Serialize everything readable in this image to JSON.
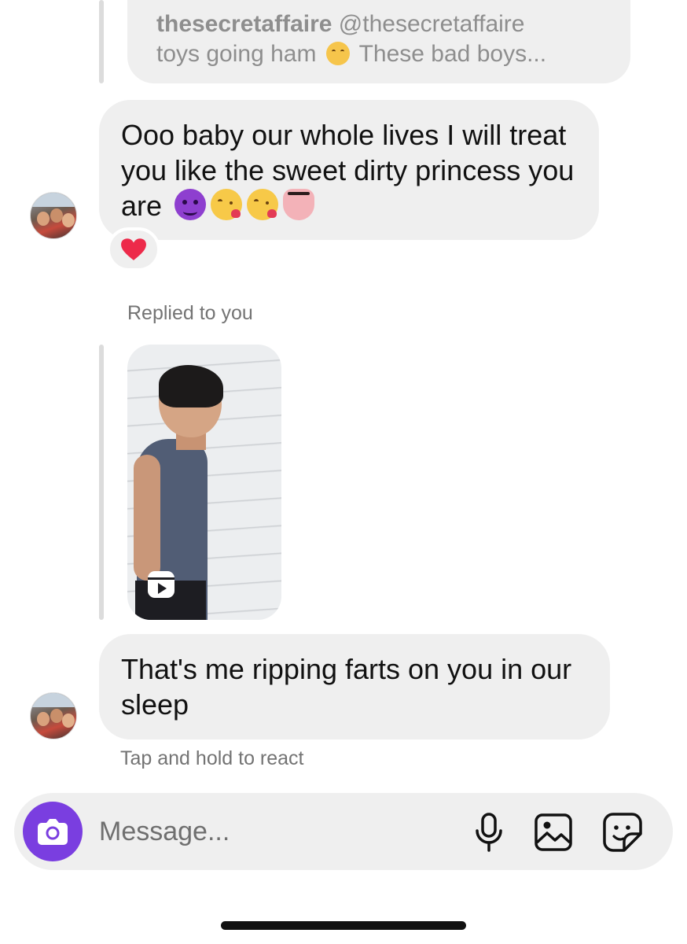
{
  "shared_post": {
    "username": "thesecretaffaire",
    "handle": "@thesecretaffaire",
    "caption_start": "toys going ham",
    "caption_end": "These bad boys..."
  },
  "messages": [
    {
      "text": "Ooo baby our whole lives I will treat you like the sweet dirty princess you are",
      "emojis": [
        "smiling-devil-emoji",
        "face-blowing-kiss-emoji",
        "face-blowing-kiss-emoji",
        "tongue-emoji"
      ],
      "reaction": "red-heart-emoji"
    },
    {
      "text": "That's me ripping farts on you in our sleep"
    }
  ],
  "reply_label": "Replied to you",
  "reaction_hint": "Tap and hold to react",
  "composer": {
    "placeholder": "Message...",
    "accent_color": "#7a3ee0"
  }
}
